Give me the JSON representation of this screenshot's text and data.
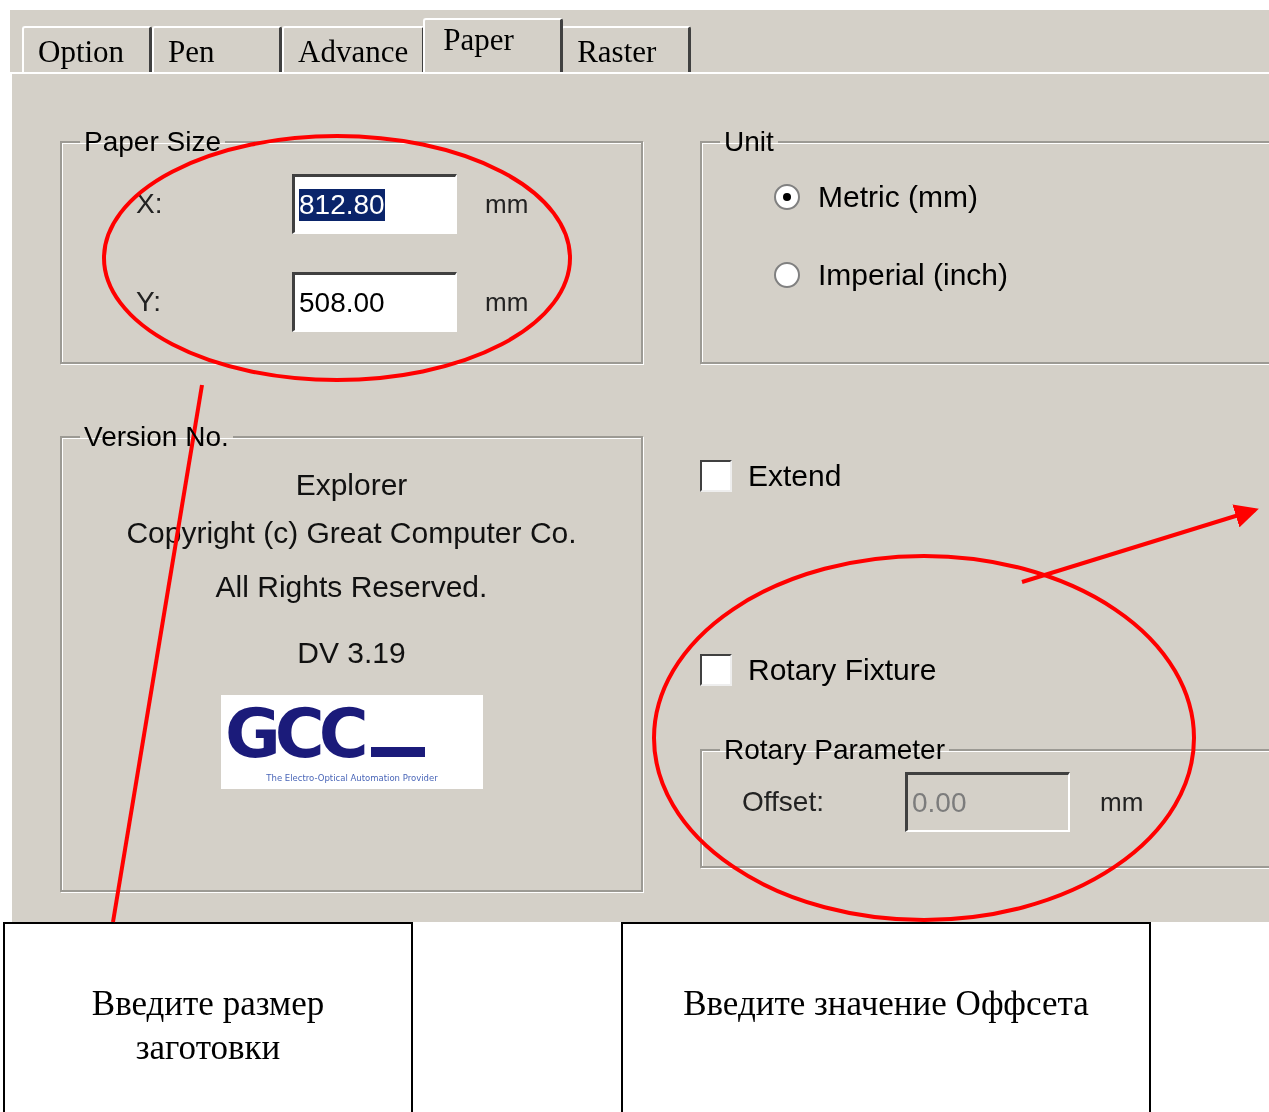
{
  "tabs": [
    {
      "label": "Option",
      "selected": false
    },
    {
      "label": "Pen",
      "selected": false
    },
    {
      "label": "Advance",
      "selected": false
    },
    {
      "label": "Paper",
      "selected": true
    },
    {
      "label": "Raster",
      "selected": false
    }
  ],
  "paper_size": {
    "title": "Paper Size",
    "fields": [
      {
        "label": "X:",
        "value": "812.80",
        "unit": "mm",
        "selected": true
      },
      {
        "label": "Y:",
        "value": "508.00",
        "unit": "mm",
        "selected": false
      }
    ]
  },
  "version": {
    "title": "Version No.",
    "lines": [
      "Explorer",
      "Copyright (c) Great Computer Co.",
      "All Rights Reserved.",
      "DV 3.19"
    ],
    "logo": {
      "mark": "GCC",
      "tagline": "The Electro-Optical Automation Provider"
    }
  },
  "unit": {
    "title": "Unit",
    "options": [
      {
        "label": "Metric (mm)",
        "selected": true
      },
      {
        "label": "Imperial (inch)",
        "selected": false
      }
    ]
  },
  "extend": {
    "label": "Extend",
    "checked": false
  },
  "rotary_fixture": {
    "label": "Rotary Fixture",
    "checked": false
  },
  "rotary_parameter": {
    "title": "Rotary Parameter",
    "offset": {
      "label": "Offset:",
      "value": "0.00",
      "unit": "mm",
      "disabled": true
    }
  },
  "callouts": [
    {
      "text": "Введите размер заготовки"
    },
    {
      "text": "Введите значение Оффсета"
    }
  ]
}
